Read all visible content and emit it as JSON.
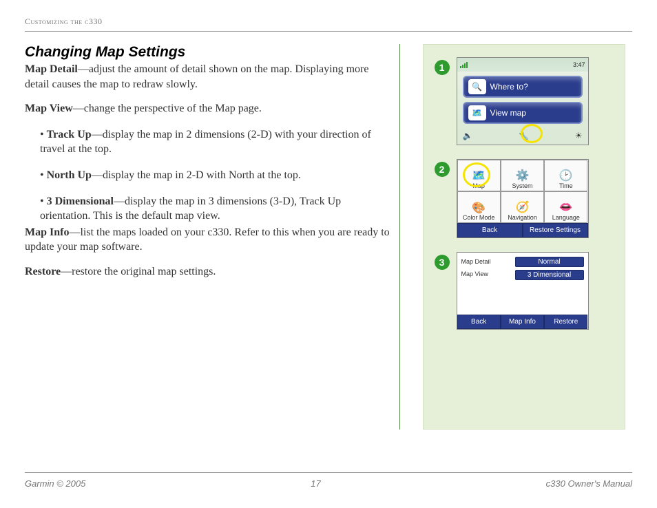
{
  "header": "Customizing the c330",
  "title": "Changing Map Settings",
  "paragraphs": {
    "mapDetail_label": "Map Detail",
    "mapDetail_text": "—adjust the amount of detail shown on the map. Displaying more detail causes the map to redraw slowly.",
    "mapView_label": "Map View",
    "mapView_text": "—change the perspective of the Map page.",
    "mapInfo_label": "Map Info",
    "mapInfo_text": "—list the maps loaded on your c330. Refer to this when you are ready to update your map software.",
    "restore_label": "Restore",
    "restore_text": "—restore the original map settings."
  },
  "bullets": {
    "trackUp_label": "Track Up",
    "trackUp_text": "—display the map in 2 dimensions (2-D) with your direction of travel at the top.",
    "northUp_label": "North Up",
    "northUp_text": "—display the map in 2-D with North at the top.",
    "threeD_label": "3 Dimensional",
    "threeD_text": "—display the map in 3 dimensions (3-D), Track Up orientation. This is the default map view."
  },
  "steps": {
    "one": "➊",
    "two": "➋",
    "three": "➌"
  },
  "screen1": {
    "time": "3:47",
    "whereTo": "Where to?",
    "viewMap": "View map"
  },
  "screen2": {
    "cells": [
      "Map",
      "System",
      "Time",
      "Color Mode",
      "Navigation",
      "Language"
    ],
    "back": "Back",
    "restore": "Restore Settings"
  },
  "screen3": {
    "row1": "Map Detail",
    "row2": "Map View",
    "val1": "Normal",
    "val2": "3 Dimensional",
    "back": "Back",
    "mapInfo": "Map Info",
    "restore": "Restore"
  },
  "footer": {
    "left": "Garmin © 2005",
    "center": "17",
    "right": "c330 Owner's Manual"
  }
}
